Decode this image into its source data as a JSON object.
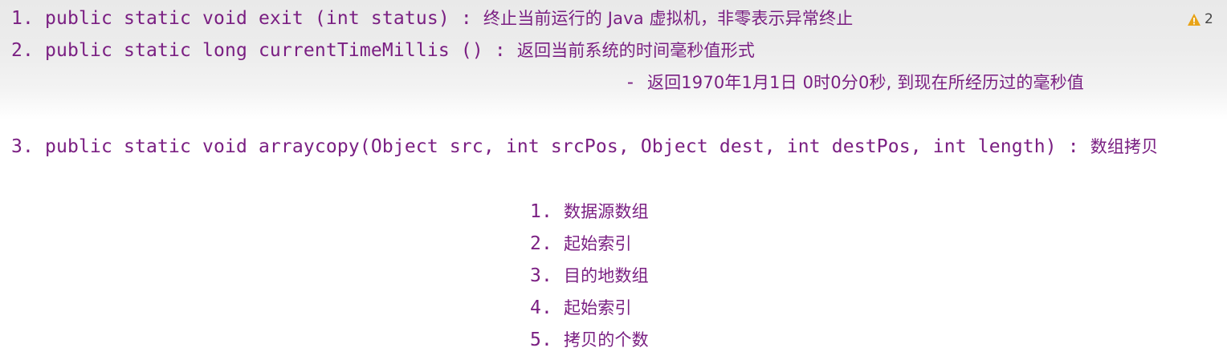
{
  "lines": [
    {
      "code": "1. public static void exit (int status) : ",
      "text": "终止当前运行的 Java 虚拟机，非零表示异常终止"
    },
    {
      "code": "2. public static long currentTimeMillis () : ",
      "text": "返回当前系统的时间毫秒值形式"
    },
    {
      "code": "- ",
      "text": "返回1970年1月1日 0时0分0秒, 到现在所经历过的毫秒值"
    },
    {
      "code": "3. public static void arraycopy(Object src, int srcPos, Object dest, int destPos, int length) : ",
      "text": "数组拷贝"
    },
    {
      "code": "1. ",
      "text": "数据源数组"
    },
    {
      "code": "2. ",
      "text": "起始索引"
    },
    {
      "code": "3. ",
      "text": "目的地数组"
    },
    {
      "code": "4. ",
      "text": "起始索引"
    },
    {
      "code": "5. ",
      "text": "拷贝的个数"
    }
  ],
  "inspection": {
    "icon": "warning-triangle-icon",
    "count": "2",
    "color": "#e8a317"
  },
  "colors": {
    "text": "#7a1f82"
  }
}
